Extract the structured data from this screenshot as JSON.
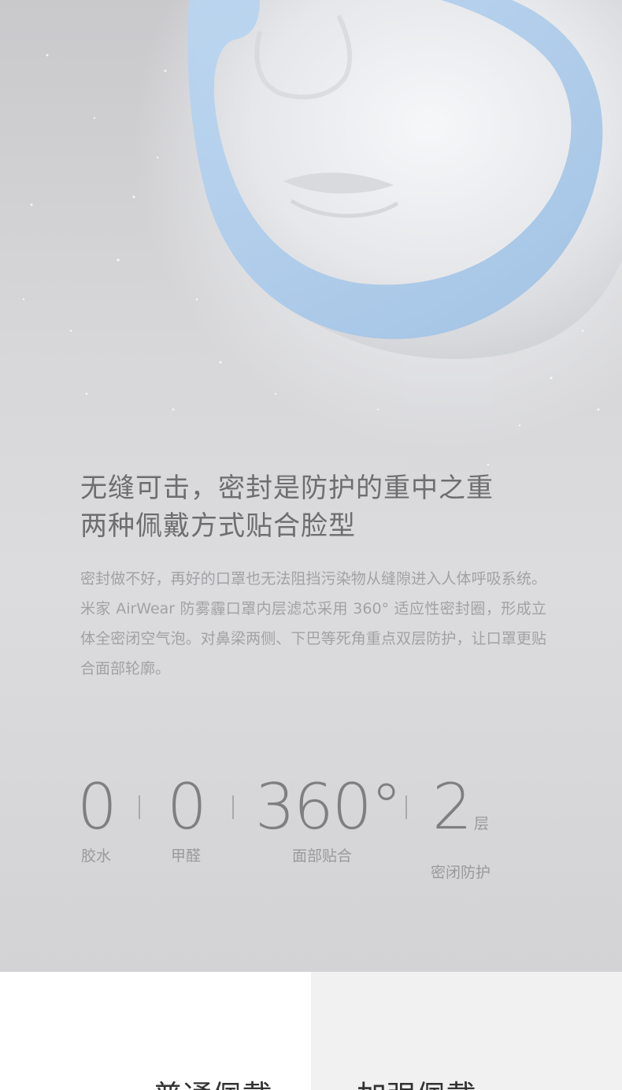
{
  "headline": {
    "line1": "无缝可击，密封是防护的重中之重",
    "line2": "两种佩戴方式贴合脸型"
  },
  "body": "密封做不好，再好的口罩也无法阻挡污染物从缝隙进入人体呼吸系统。米家 AirWear 防雾霾口罩内层滤芯采用 360° 适应性密封圈，形成立体全密闭空气泡。对鼻梁两侧、下巴等死角重点双层防护，让口罩更贴合面部轮廓。",
  "stats": [
    {
      "value": "0",
      "unit": "",
      "label": "胶水"
    },
    {
      "value": "0",
      "unit": "",
      "label": "甲醛"
    },
    {
      "value": "360°",
      "unit": "",
      "label": "面部贴合"
    },
    {
      "value": "2",
      "unit": "层",
      "label": "密闭防护"
    }
  ],
  "tabs": {
    "left": "普通佩戴",
    "right": "加强佩戴"
  },
  "colors": {
    "mask_blue": "#a9c9ea",
    "headline": "#6e6e70",
    "body_text": "#a2a2a5",
    "tab_right_bg": "#f1f1f1"
  }
}
